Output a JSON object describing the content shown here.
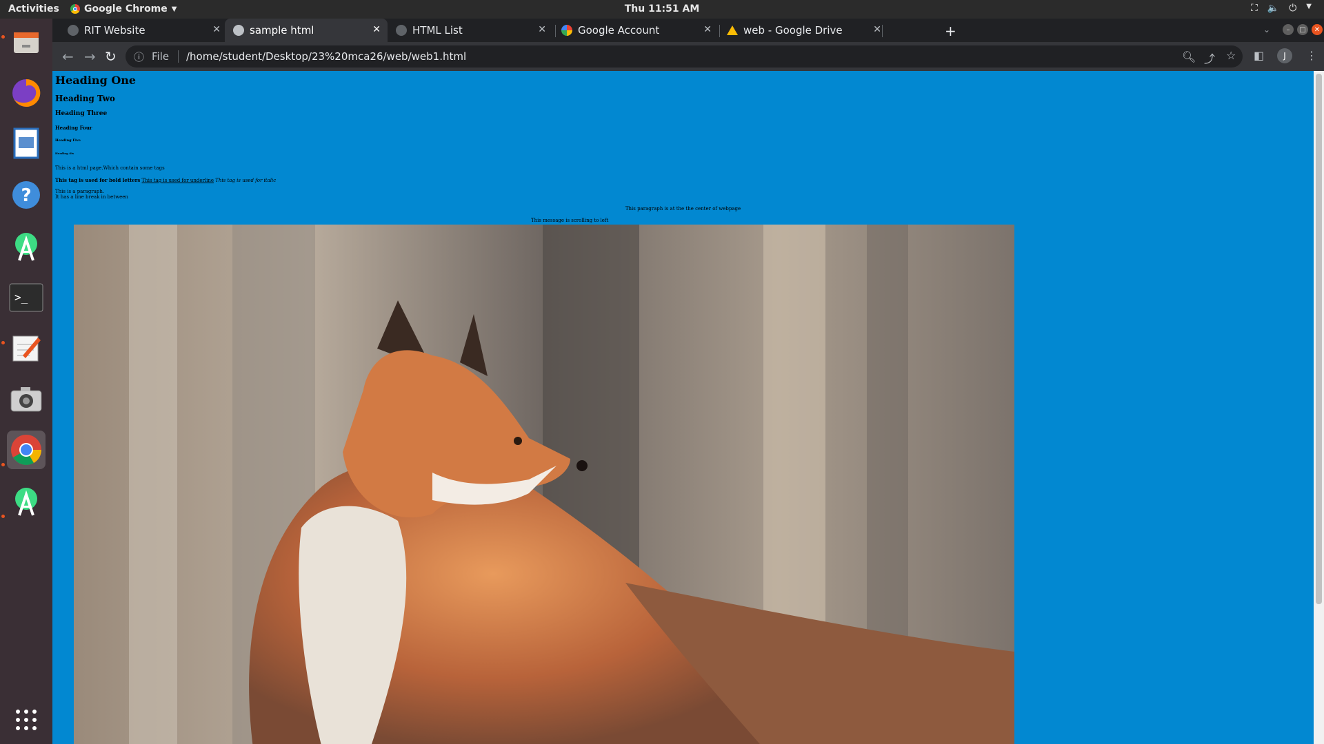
{
  "system": {
    "activities": "Activities",
    "app_name": "Google Chrome",
    "clock": "Thu 11:51 AM"
  },
  "tabs": [
    {
      "title": "RIT Website",
      "active": false
    },
    {
      "title": "sample html",
      "active": true
    },
    {
      "title": "HTML List",
      "active": false
    },
    {
      "title": "Google Account",
      "active": false
    },
    {
      "title": "web - Google Drive",
      "active": false
    }
  ],
  "toolbar": {
    "scheme_label": "File",
    "url": "/home/student/Desktop/23%20mca26/web/web1.html",
    "avatar_initial": "J"
  },
  "page": {
    "background_color": "#0288d1",
    "h1": "Heading One",
    "h2": "Heading Two",
    "h3": "Heading Three",
    "h4": "Heading Four",
    "h5": "Heading Five",
    "h6": "Heading Six",
    "intro": "This is a html page.Which contain some tags",
    "bold_text": "This tag is used for bold letters",
    "underline_text": "This tag is used for underline",
    "italic_text": "This tag is used for italic",
    "para_line1": "This is a paragraph.",
    "para_line2": "It has a line break in between",
    "center_text": "This paragraph is at the the center of webpage",
    "marquee_text": "This message is scrolling to left"
  },
  "dock": [
    {
      "name": "files-icon",
      "running": true
    },
    {
      "name": "firefox-icon",
      "running": false
    },
    {
      "name": "writer-icon",
      "running": false
    },
    {
      "name": "help-icon",
      "running": false
    },
    {
      "name": "android-studio-icon",
      "running": false
    },
    {
      "name": "terminal-icon",
      "running": false
    },
    {
      "name": "text-editor-icon",
      "running": true
    },
    {
      "name": "screenshot-icon",
      "running": false
    },
    {
      "name": "chrome-icon",
      "running": true
    },
    {
      "name": "android-studio-icon-2",
      "running": true
    }
  ]
}
